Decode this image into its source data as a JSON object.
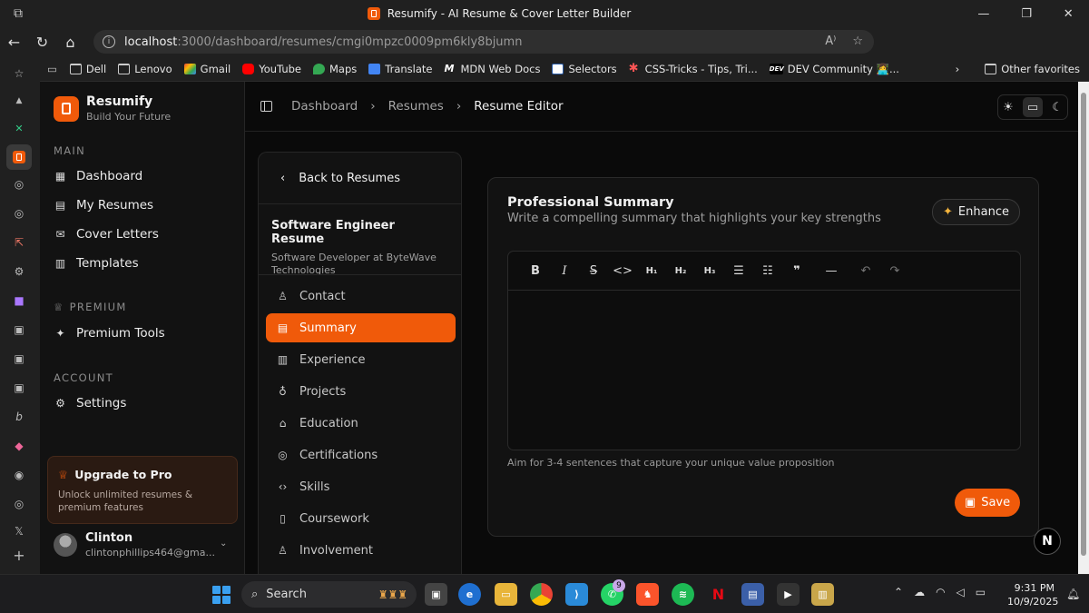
{
  "browser": {
    "tab_title": "Resumify - AI Resume & Cover Letter Builder",
    "url_host": "localhost",
    "url_path": ":3000/dashboard/resumes/cmgi0mpzc0009pm6kly8bjumn",
    "bookmarks": [
      "Dell",
      "Lenovo",
      "Gmail",
      "YouTube",
      "Maps",
      "Translate",
      "MDN Web Docs",
      "Selectors",
      "CSS-Tricks - Tips, Tri...",
      "DEV Community 👩‍💻..."
    ],
    "other_favorites": "Other favorites"
  },
  "sidebar": {
    "brand_name": "Resumify",
    "brand_tagline": "Build Your Future",
    "section_main": "MAIN",
    "main_items": [
      "Dashboard",
      "My Resumes",
      "Cover Letters",
      "Templates"
    ],
    "section_premium": "PREMIUM",
    "premium_item": "Premium Tools",
    "section_account": "ACCOUNT",
    "account_item": "Settings",
    "upgrade_title": "Upgrade to Pro",
    "upgrade_subtitle": "Unlock unlimited resumes & premium features",
    "user_name": "Clinton",
    "user_email": "clintonphillips464@gma..."
  },
  "breadcrumb": [
    "Dashboard",
    "Resumes",
    "Resume Editor"
  ],
  "editor_nav": {
    "back_label": "Back to Resumes",
    "resume_title": "Software Engineer Resume",
    "resume_subtitle": "Software Developer at ByteWave Technologies",
    "sections": [
      "Contact",
      "Summary",
      "Experience",
      "Projects",
      "Education",
      "Certifications",
      "Skills",
      "Coursework",
      "Involvement"
    ],
    "active_section": "Summary"
  },
  "card": {
    "title": "Professional Summary",
    "subtitle": "Write a compelling summary that highlights your key strengths",
    "enhance_label": "Enhance",
    "toolbar": [
      "B",
      "I",
      "S",
      "<>",
      "H1",
      "H2",
      "H3",
      "bullet-list",
      "ordered-list",
      "quote",
      "rule",
      "undo",
      "redo"
    ],
    "hint": "Aim for 3-4 sentences that capture your unique value proposition",
    "save_label": "Save"
  },
  "dev_badge": "N",
  "taskbar": {
    "search_label": "Search",
    "whatsapp_badge": "9",
    "time": "9:31 PM",
    "date": "10/9/2025"
  },
  "colors": {
    "accent": "#f05a0a",
    "background": "#0a0a0a",
    "panel": "#121212"
  }
}
